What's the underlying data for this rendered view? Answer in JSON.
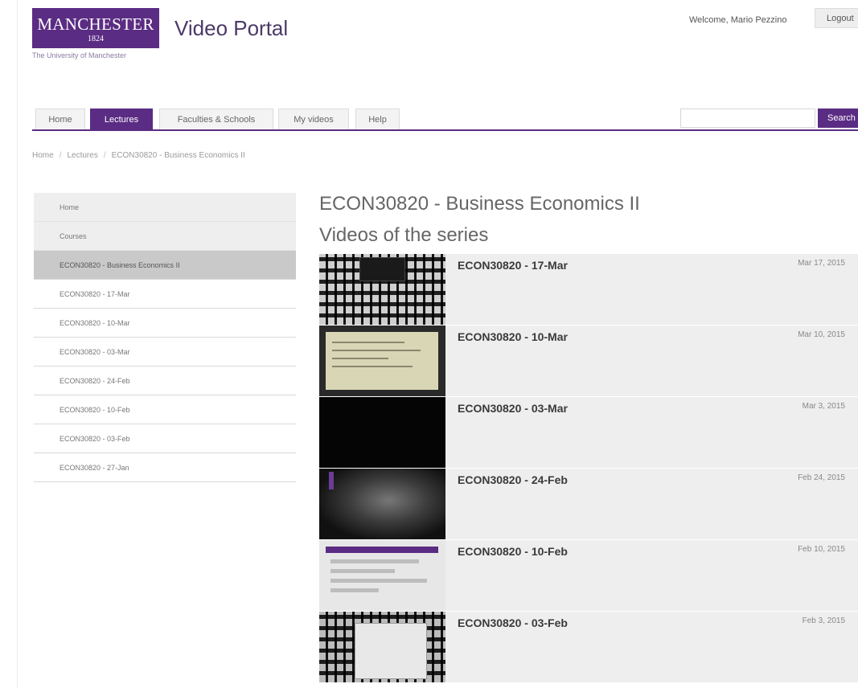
{
  "logo": {
    "wordmark": "MANCHESTER",
    "year": "1824",
    "subtitle": "The University of Manchester"
  },
  "header": {
    "app_title": "Video Portal",
    "welcome": "Welcome, Mario Pezzino",
    "logout_label": "Logout"
  },
  "nav": {
    "tabs": [
      {
        "label": "Home",
        "active": false
      },
      {
        "label": "Lectures",
        "active": true
      },
      {
        "label": "Faculties & Schools",
        "active": false
      },
      {
        "label": "My videos",
        "active": false
      },
      {
        "label": "Help",
        "active": false
      }
    ],
    "search_button": "Search"
  },
  "breadcrumb": [
    "Home",
    "Lectures",
    "ECON30820 - Business Economics II"
  ],
  "sidebar": {
    "items": [
      {
        "label": "Home"
      },
      {
        "label": "Courses"
      },
      {
        "label": "ECON30820 - Business Economics II",
        "selected": true
      },
      {
        "label": "ECON30820 - 17-Mar"
      },
      {
        "label": "ECON30820 - 10-Mar"
      },
      {
        "label": "ECON30820 - 03-Mar"
      },
      {
        "label": "ECON30820 - 24-Feb"
      },
      {
        "label": "ECON30820 - 10-Feb"
      },
      {
        "label": "ECON30820 - 03-Feb"
      },
      {
        "label": "ECON30820 - 27-Jan"
      }
    ]
  },
  "main": {
    "title": "ECON30820 - Business Economics II",
    "subtitle": "Videos of the series",
    "videos": [
      {
        "title": "ECON30820 - 17-Mar",
        "date": "Mar 17, 2015"
      },
      {
        "title": "ECON30820 - 10-Mar",
        "date": "Mar 10, 2015"
      },
      {
        "title": "ECON30820 - 03-Mar",
        "date": "Mar 3, 2015"
      },
      {
        "title": "ECON30820 - 24-Feb",
        "date": "Feb 24, 2015"
      },
      {
        "title": "ECON30820 - 10-Feb",
        "date": "Feb 10, 2015"
      },
      {
        "title": "ECON30820 - 03-Feb",
        "date": "Feb 3, 2015"
      }
    ]
  },
  "colors": {
    "brand_purple": "#5b2c83",
    "row_background": "#eeeeee",
    "selected_item": "#c9c9c9"
  }
}
